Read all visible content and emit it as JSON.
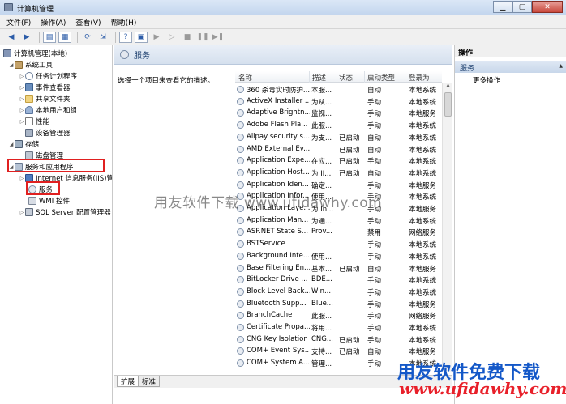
{
  "window": {
    "title": "计算机管理"
  },
  "window_buttons": {
    "minimize": "▁",
    "maximize": "▢",
    "close": "✕"
  },
  "menu": [
    "文件(F)",
    "操作(A)",
    "查看(V)",
    "帮助(H)"
  ],
  "tree": [
    {
      "label": "计算机管理(本地)",
      "icon": "computer-icon",
      "level": 0,
      "arrow": ""
    },
    {
      "label": "系统工具",
      "icon": "tools-icon",
      "level": 1,
      "arrow": "◢"
    },
    {
      "label": "任务计划程序",
      "icon": "clock-icon",
      "level": 2,
      "arrow": "▷"
    },
    {
      "label": "事件查看器",
      "icon": "event-viewer-icon",
      "level": 2,
      "arrow": "▷"
    },
    {
      "label": "共享文件夹",
      "icon": "folder-icon",
      "level": 2,
      "arrow": "▷"
    },
    {
      "label": "本地用户和组",
      "icon": "users-icon",
      "level": 2,
      "arrow": "▷"
    },
    {
      "label": "性能",
      "icon": "performance-icon",
      "level": 2,
      "arrow": "▷"
    },
    {
      "label": "设备管理器",
      "icon": "device-manager-icon",
      "level": 2,
      "arrow": ""
    },
    {
      "label": "存储",
      "icon": "storage-icon",
      "level": 1,
      "arrow": "◢"
    },
    {
      "label": "磁盘管理",
      "icon": "disk-icon",
      "level": 2,
      "arrow": ""
    },
    {
      "label": "服务和应用程序",
      "icon": "services-apps-icon",
      "level": 1,
      "arrow": "◢"
    },
    {
      "label": "Internet 信息服务(IIS)管",
      "icon": "iis-icon",
      "level": 2,
      "arrow": "▷"
    },
    {
      "label": "服务",
      "icon": "gear-icon",
      "level": 2,
      "arrow": ""
    },
    {
      "label": "WMI 控件",
      "icon": "wmi-icon",
      "level": 2,
      "arrow": ""
    },
    {
      "label": "SQL Server 配置管理器",
      "icon": "sql-icon",
      "level": 2,
      "arrow": "▷"
    }
  ],
  "services_panel": {
    "header": "服务",
    "description_prompt": "选择一个项目来查看它的描述。",
    "columns": {
      "name": "名称",
      "desc": "描述",
      "status": "状态",
      "startup": "启动类型",
      "logon": "登录为"
    },
    "rows": [
      {
        "name": "360 杀毒实时防护...",
        "desc": "本服...",
        "status": "",
        "startup": "自动",
        "logon": "本地系统"
      },
      {
        "name": "ActiveX Installer ...",
        "desc": "为从...",
        "status": "",
        "startup": "手动",
        "logon": "本地系统"
      },
      {
        "name": "Adaptive Brightn...",
        "desc": "监视...",
        "status": "",
        "startup": "手动",
        "logon": "本地服务"
      },
      {
        "name": "Adobe Flash Pla...",
        "desc": "此服...",
        "status": "",
        "startup": "手动",
        "logon": "本地系统"
      },
      {
        "name": "Alipay security s...",
        "desc": "为支...",
        "status": "已启动",
        "startup": "自动",
        "logon": "本地系统"
      },
      {
        "name": "AMD External Ev...",
        "desc": "",
        "status": "已启动",
        "startup": "自动",
        "logon": "本地系统"
      },
      {
        "name": "Application Expe...",
        "desc": "在应...",
        "status": "已启动",
        "startup": "手动",
        "logon": "本地系统"
      },
      {
        "name": "Application Host...",
        "desc": "为 II...",
        "status": "已启动",
        "startup": "自动",
        "logon": "本地系统"
      },
      {
        "name": "Application Iden...",
        "desc": "确定...",
        "status": "",
        "startup": "手动",
        "logon": "本地服务"
      },
      {
        "name": "Application Infor...",
        "desc": "使用...",
        "status": "",
        "startup": "手动",
        "logon": "本地系统"
      },
      {
        "name": "Application Laye...",
        "desc": "为 In...",
        "status": "",
        "startup": "手动",
        "logon": "本地服务"
      },
      {
        "name": "Application Man...",
        "desc": "为通...",
        "status": "",
        "startup": "手动",
        "logon": "本地系统"
      },
      {
        "name": "ASP.NET State S...",
        "desc": "Prov...",
        "status": "",
        "startup": "禁用",
        "logon": "网络服务"
      },
      {
        "name": "BSTService",
        "desc": "",
        "status": "",
        "startup": "手动",
        "logon": "本地系统"
      },
      {
        "name": "Background Inte...",
        "desc": "使用...",
        "status": "",
        "startup": "手动",
        "logon": "本地系统"
      },
      {
        "name": "Base Filtering En...",
        "desc": "基本...",
        "status": "已启动",
        "startup": "自动",
        "logon": "本地服务"
      },
      {
        "name": "BitLocker Drive ...",
        "desc": "BDE...",
        "status": "",
        "startup": "手动",
        "logon": "本地系统"
      },
      {
        "name": "Block Level Back...",
        "desc": "Win...",
        "status": "",
        "startup": "手动",
        "logon": "本地系统"
      },
      {
        "name": "Bluetooth Supp...",
        "desc": "Blue...",
        "status": "",
        "startup": "手动",
        "logon": "本地服务"
      },
      {
        "name": "BranchCache",
        "desc": "此服...",
        "status": "",
        "startup": "手动",
        "logon": "网络服务"
      },
      {
        "name": "Certificate Propa...",
        "desc": "将用...",
        "status": "",
        "startup": "手动",
        "logon": "本地系统"
      },
      {
        "name": "CNG Key Isolation",
        "desc": "CNG...",
        "status": "已启动",
        "startup": "手动",
        "logon": "本地系统"
      },
      {
        "name": "COM+ Event Sys...",
        "desc": "支持...",
        "status": "已启动",
        "startup": "自动",
        "logon": "本地服务"
      },
      {
        "name": "COM+ System A...",
        "desc": "管理...",
        "status": "",
        "startup": "手动",
        "logon": "本地系统"
      }
    ],
    "tabs": [
      "扩展",
      "标准"
    ]
  },
  "actions_panel": {
    "title": "操作",
    "section": "服务",
    "more": "更多操作"
  },
  "watermarks": {
    "center": "用友软件下载  www.ufidawhy.com",
    "brand": "用友软件免费下载",
    "url": "www.ufidawhy.com"
  }
}
